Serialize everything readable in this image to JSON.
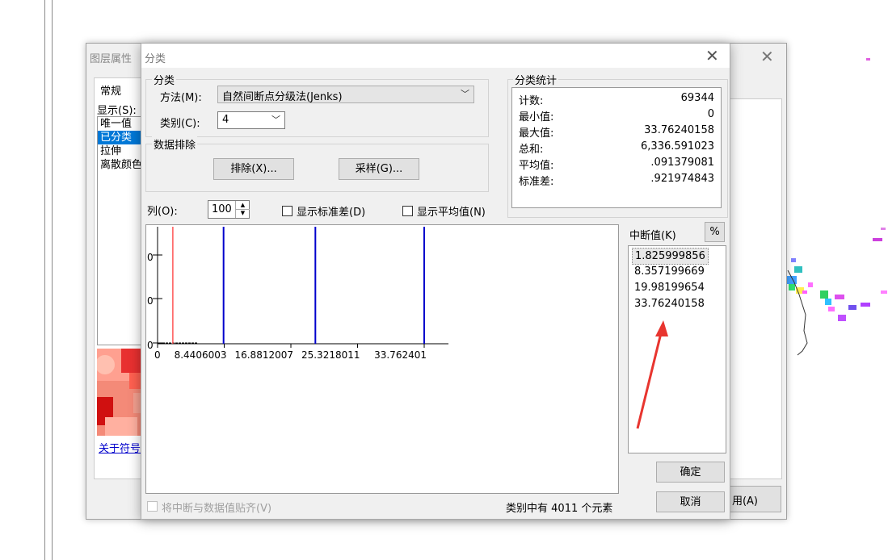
{
  "background_dialog": {
    "title": "图层属性",
    "tab_general": "常规",
    "show_label": "显示(S):",
    "list_items": [
      "唯一值",
      "已分类",
      "拉伸",
      "离散颜色"
    ],
    "selected_index": 1,
    "symbol_link": "关于符号",
    "apply_label": "用(A)"
  },
  "dialog": {
    "title": "分类",
    "classification_group": "分类",
    "method_label": "方法(M):",
    "method_value": "自然间断点分级法(Jenks)",
    "classes_label": "类别(C):",
    "classes_value": "4",
    "exclusion_group": "数据排除",
    "exclude_button": "排除(X)...",
    "sampling_button": "采样(G)...",
    "columns_label": "列(O):",
    "columns_value": "100",
    "show_std_label": "显示标准差(D)",
    "show_mean_label": "显示平均值(N)",
    "snap_label": "将中断与数据值贴齐(V)",
    "status_prefix": "类别中有",
    "status_count": "4011",
    "status_suffix": "个元素",
    "ok_button": "确定",
    "cancel_button": "取消",
    "breaks_label": "中断值(K)",
    "percent_button": "%",
    "break_values": [
      "1.825999856",
      "8.357199669",
      "19.98199654",
      "33.76240158"
    ]
  },
  "stats": {
    "group_label": "分类统计",
    "rows": [
      {
        "key": "计数:",
        "value": "69344"
      },
      {
        "key": "最小值:",
        "value": "0"
      },
      {
        "key": "最大值:",
        "value": "33.76240158"
      },
      {
        "key": "总和:",
        "value": "6,336.591023"
      },
      {
        "key": "平均值:",
        "value": ".091379081"
      },
      {
        "key": "标准差:",
        "value": ".921974843"
      }
    ]
  },
  "chart_data": {
    "type": "bar",
    "x_tick_labels": [
      "0",
      "8.4406003",
      "16.8812007",
      "25.3218011",
      "33.762401"
    ],
    "y_tick_labels": [
      "0",
      "0",
      "0"
    ],
    "xlim": [
      0,
      33.76240158
    ],
    "break_lines": [
      8.357199669,
      19.98199654,
      33.76240158
    ],
    "mean_line": 0.091379081,
    "colors": {
      "break_line": "#0000cc",
      "mean_line": "#ff5555",
      "bars": "#000000"
    }
  },
  "colors": {
    "selection": "#0078d7",
    "link": "#0000cc",
    "annotation_arrow": "#e8352f"
  }
}
